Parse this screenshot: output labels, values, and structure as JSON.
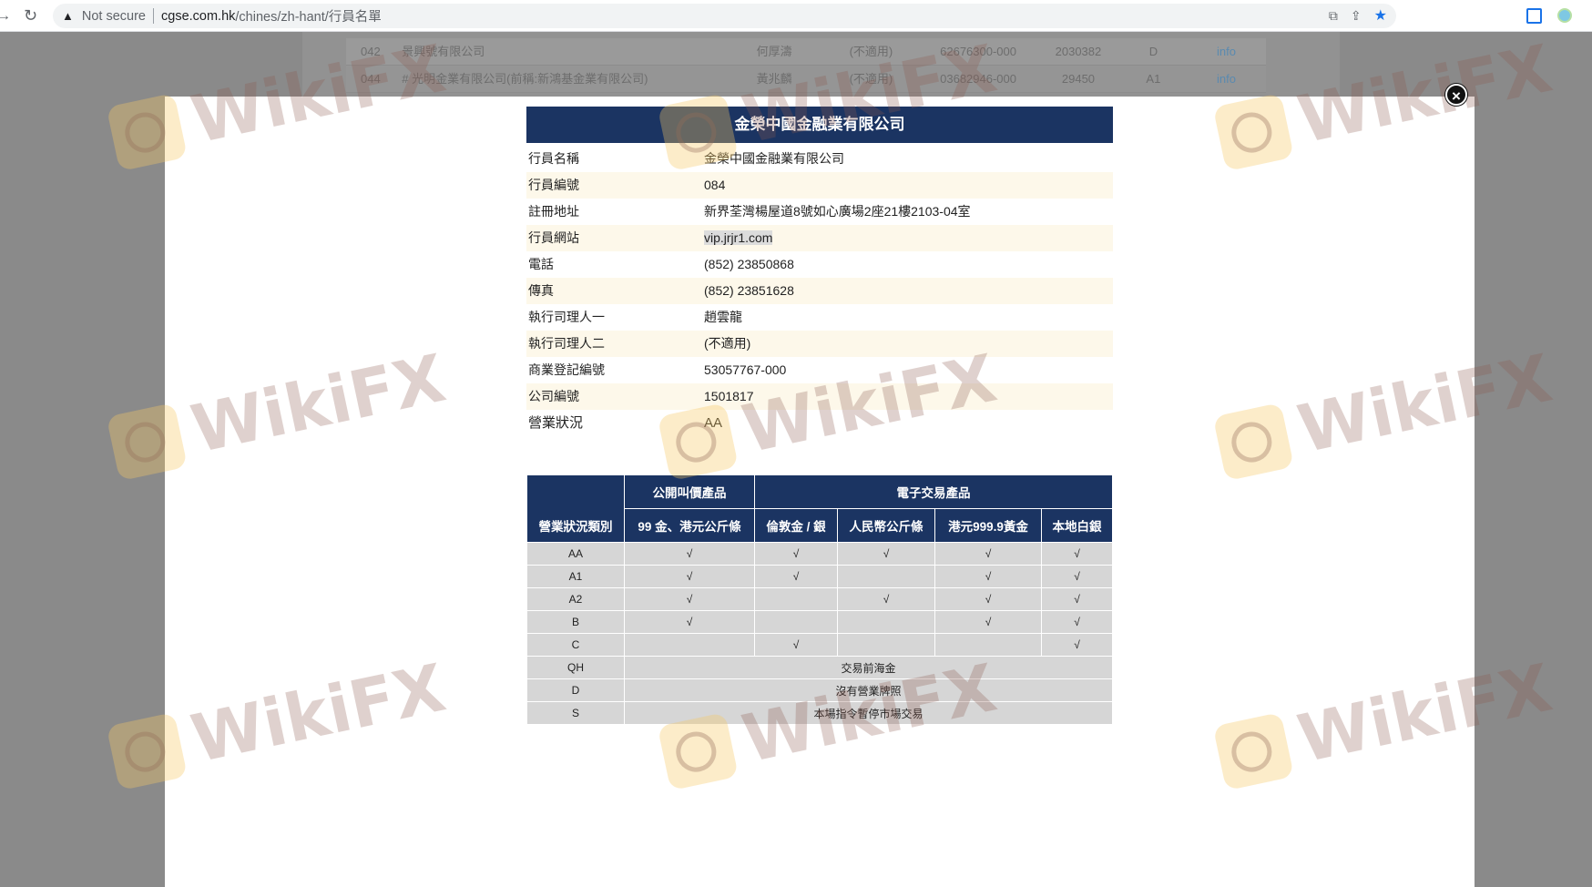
{
  "browser": {
    "not_secure": "Not secure",
    "url_host": "cgse.com.hk",
    "url_path": "/chines/zh-hant/行員名單"
  },
  "background_rows": [
    [
      "042",
      "景興號有限公司",
      "何厚濤",
      "(不適用)",
      "62676300-000",
      "2030382",
      "D",
      "info"
    ],
    [
      "044",
      "# 光明金業有限公司(前稱:新鴻基金業有限公司)",
      "黃兆麟",
      "(不適用)",
      "03682946-000",
      "29450",
      "A1",
      "info"
    ]
  ],
  "company": {
    "title": "金榮中國金融業有限公司",
    "rows": [
      {
        "label": "行員名稱",
        "value": "金榮中國金融業有限公司"
      },
      {
        "label": "行員編號",
        "value": "084"
      },
      {
        "label": "註冊地址",
        "value": "新界荃灣楊屋道8號如心廣場2座21樓2103-04室"
      },
      {
        "label": "行員網站",
        "value": "vip.jrjr1.com"
      },
      {
        "label": "電話",
        "value": "(852) 23850868"
      },
      {
        "label": "傳真",
        "value": "(852) 23851628"
      },
      {
        "label": "執行司理人一",
        "value": "趙雲龍"
      },
      {
        "label": "執行司理人二",
        "value": "(不適用)"
      },
      {
        "label": "商業登記編號",
        "value": "53057767-000"
      },
      {
        "label": "公司編號",
        "value": "1501817"
      },
      {
        "label": "營業狀況",
        "value": "AA"
      }
    ]
  },
  "status_table": {
    "category_header": "營業狀況類別",
    "group_public": "公開叫價產品",
    "group_electronic": "電子交易產品",
    "columns": [
      "99 金、港元公斤條",
      "倫敦金 / 銀",
      "人民幣公斤條",
      "港元999.9黃金",
      "本地白銀"
    ],
    "rows": [
      {
        "code": "AA",
        "marks": [
          "√",
          "√",
          "√",
          "√",
          "√"
        ]
      },
      {
        "code": "A1",
        "marks": [
          "√",
          "√",
          "",
          "√",
          "√"
        ]
      },
      {
        "code": "A2",
        "marks": [
          "√",
          "",
          "√",
          "√",
          "√"
        ]
      },
      {
        "code": "B",
        "marks": [
          "√",
          "",
          "",
          "√",
          "√"
        ]
      },
      {
        "code": "C",
        "marks": [
          "",
          "√",
          "",
          "",
          "√"
        ]
      }
    ],
    "span_rows": [
      {
        "code": "QH",
        "text": "交易前海金"
      },
      {
        "code": "D",
        "text": "沒有營業牌照"
      },
      {
        "code": "S",
        "text": "本場指令暫停市場交易"
      }
    ]
  },
  "watermark": {
    "text": "WikiFX"
  }
}
